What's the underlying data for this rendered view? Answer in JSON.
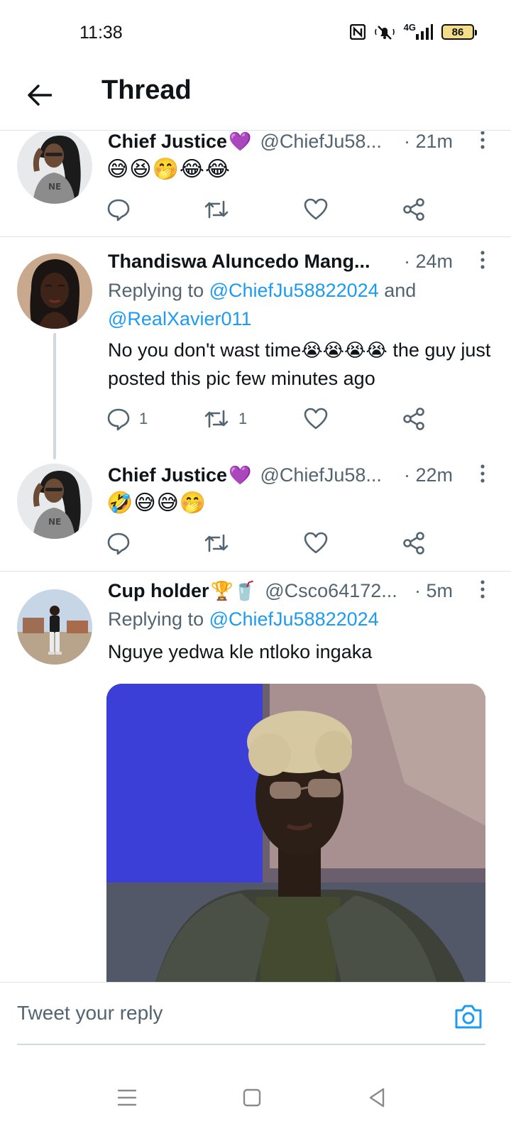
{
  "status_bar": {
    "time": "11:38",
    "network": "4G",
    "battery": "86"
  },
  "header": {
    "title": "Thread"
  },
  "tweets": [
    {
      "name": "Chief Justice",
      "badge": "💜",
      "handle": "@ChiefJu58...",
      "time": "· 21m",
      "emojis": "😅😆🤭😂😂"
    },
    {
      "name": "Thandiswa Aluncedo Mang...",
      "time": "· 24m",
      "replying_prefix": "Replying to ",
      "replying_handle_1": "@ChiefJu58822024",
      "replying_and": " and",
      "replying_handle_2": "@RealXavier011",
      "text_before": "No you don't wast time",
      "text_emojis": "😭😭😭😭",
      "text_after": " the guy just posted this pic few minutes ago",
      "reply_count": "1",
      "retweet_count": "1"
    },
    {
      "name": "Chief Justice",
      "badge": "💜",
      "handle": "@ChiefJu58...",
      "time": "· 22m",
      "emojis": "🤣😅😅🤭"
    },
    {
      "name": "Cup holder",
      "badge": "🏆🥤",
      "handle": "@Csco64172...",
      "time": "· 5m",
      "replying_prefix": "Replying to ",
      "replying_handle_1": "@ChiefJu58822024",
      "text": "Nguye yedwa kle ntloko ingaka"
    }
  ],
  "reply_bar": {
    "placeholder": "Tweet your reply"
  },
  "colors": {
    "accent": "#1d9bf0",
    "secondary_text": "#536471",
    "divider": "#dfe3e6",
    "battery_fill": "#f3dc8a"
  },
  "icons": [
    "nfc-icon",
    "mute-icon",
    "signal-icon",
    "battery-icon",
    "back-arrow-icon",
    "more-icon",
    "reply-icon",
    "retweet-icon",
    "like-icon",
    "share-icon",
    "camera-icon",
    "menu-icon",
    "home-icon",
    "back-icon"
  ]
}
